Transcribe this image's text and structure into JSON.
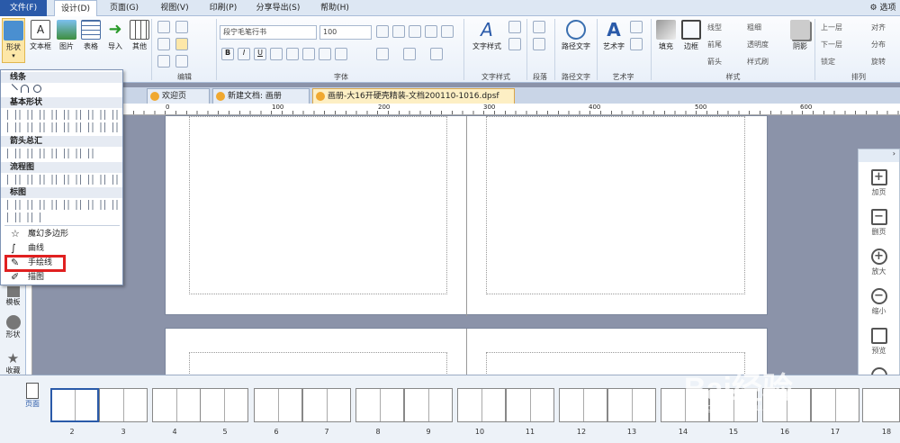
{
  "menubar": {
    "items": [
      "文件(F)",
      "设计(D)",
      "页面(G)",
      "视图(V)",
      "印刷(P)",
      "分享导出(S)",
      "帮助(H)"
    ],
    "options": "选项"
  },
  "ribbon": {
    "insert_buttons": [
      "形状",
      "文本框",
      "图片",
      "表格",
      "导入",
      "其他"
    ],
    "edit_label": "编辑",
    "font_name": "段宁毛笔行书",
    "font_size": "100",
    "font_label": "字体",
    "text_style_label": "文字样式",
    "text_style_btn": "文字样式",
    "paragraph_label": "段落",
    "path_text_btn": "路径文字",
    "path_text_label": "路径文字",
    "art_text_btn": "艺术字",
    "art_text_label": "艺术字",
    "fill_btn": "填充",
    "border_btn": "边框",
    "style_items": [
      "线型",
      "前尾",
      "箭头",
      "粗细",
      "透明度",
      "样式刷"
    ],
    "shadow_btn": "阴影",
    "style_label": "样式",
    "arrange_items": [
      "上一层",
      "下一层",
      "锁定",
      "对齐",
      "分布",
      "旋转"
    ],
    "arrange_label": "排列"
  },
  "tabs": [
    {
      "label": "欢迎页"
    },
    {
      "label": "新建文档: 画册"
    },
    {
      "label": "画册-大16开硬壳精装-文档200110-1016.dpsf"
    }
  ],
  "ruler": {
    "ticks": [
      "0",
      "100",
      "200",
      "300",
      "400",
      "500",
      "600"
    ]
  },
  "dropdown": {
    "sections": [
      "线条",
      "基本形状",
      "箭头总汇",
      "流程图",
      "标图"
    ],
    "items": [
      "魔幻多边形",
      "曲线",
      "手绘线",
      "描图"
    ]
  },
  "left_panel": [
    "模板",
    "形状",
    "收藏",
    "客服"
  ],
  "right_panel": [
    "加页",
    "删页",
    "放大",
    "缩小",
    "预览",
    "分享"
  ],
  "thumb_panel": {
    "label": "页面",
    "numbers": [
      "2",
      "3",
      "4",
      "5",
      "6",
      "7",
      "8",
      "9",
      "10",
      "11",
      "12",
      "13",
      "14",
      "15",
      "16",
      "17",
      "18"
    ]
  },
  "watermark": {
    "main": "Bai经验",
    "sub": "jingyan.baidu.com"
  },
  "colors": {
    "accent": "#2a5aa9",
    "highlight": "#e02020",
    "canvas": "#8b93a9"
  }
}
